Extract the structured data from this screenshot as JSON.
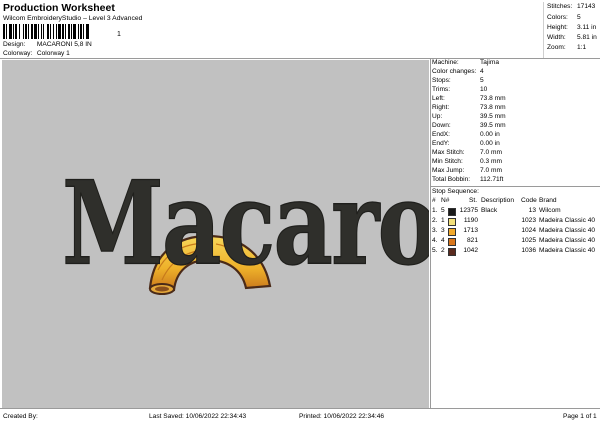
{
  "header": {
    "title": "Production Worksheet",
    "subtitle": "Wilcom EmbroideryStudio – Level 3 Advanced",
    "barcode_digit": "1",
    "design_label": "Design:",
    "design_value": "MACARONI 5,8 IN",
    "colorway_label": "Colorway:",
    "colorway_value": "Colorway 1"
  },
  "top_stats": [
    {
      "label": "Stitches:",
      "value": "17143"
    },
    {
      "label": "Colors:",
      "value": "5"
    },
    {
      "label": "Height:",
      "value": "3.11 in"
    },
    {
      "label": "Width:",
      "value": "5.81 in"
    },
    {
      "label": "Zoom:",
      "value": "1:1"
    }
  ],
  "specs": [
    {
      "label": "Machine:",
      "value": "Tajima"
    },
    {
      "label": "Color changes:",
      "value": "4"
    },
    {
      "label": "Stops:",
      "value": "5"
    },
    {
      "label": "Trims:",
      "value": "10"
    },
    {
      "label": "Left:",
      "value": "73.8 mm"
    },
    {
      "label": "Right:",
      "value": "73.8 mm"
    },
    {
      "label": "Up:",
      "value": "39.5 mm"
    },
    {
      "label": "Down:",
      "value": "39.5 mm"
    },
    {
      "label": "EndX:",
      "value": "0.00 in"
    },
    {
      "label": "EndY:",
      "value": "0.00 in"
    },
    {
      "label": "Max Stitch:",
      "value": "7.0 mm"
    },
    {
      "label": "Min Stitch:",
      "value": "0.3 mm"
    },
    {
      "label": "Max Jump:",
      "value": "7.0 mm"
    },
    {
      "label": "Total Bobbin:",
      "value": "112.71ft"
    }
  ],
  "stop_sequence": {
    "title": "Stop Sequence:",
    "headers": {
      "num": "#",
      "n": "N#",
      "st": "St.",
      "description": "Description",
      "code": "Code",
      "brand": "Brand"
    },
    "rows": [
      {
        "num": "1.",
        "n": "5",
        "color": "#1a1a1a",
        "st": "12375",
        "description": "Black",
        "code": "13",
        "brand": "Wilcom"
      },
      {
        "num": "2.",
        "n": "1",
        "color": "#f3e07a",
        "st": "1190",
        "description": "",
        "code": "1023",
        "brand": "Madeira Classic 40"
      },
      {
        "num": "3.",
        "n": "3",
        "color": "#f2a92b",
        "st": "1713",
        "description": "",
        "code": "1024",
        "brand": "Madeira Classic 40"
      },
      {
        "num": "4.",
        "n": "4",
        "color": "#d9761c",
        "st": "821",
        "description": "",
        "code": "1025",
        "brand": "Madeira Classic 40"
      },
      {
        "num": "5.",
        "n": "2",
        "color": "#5a2a1e",
        "st": "1042",
        "description": "",
        "code": "1036",
        "brand": "Madeira Classic 40"
      }
    ]
  },
  "design": {
    "text": "Macaroni",
    "text_color": "#2f2f2b",
    "bg_color": "#c1c1c1"
  },
  "footer": {
    "created_by": "Created By:",
    "last_saved": "Last Saved: 10/06/2022 22:34:43",
    "printed": "Printed: 10/06/2022 22:34:46",
    "page": "Page 1 of 1"
  }
}
